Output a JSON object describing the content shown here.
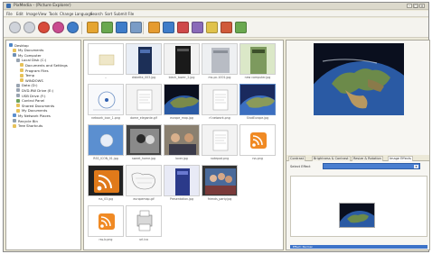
{
  "window": {
    "title": "PixMedia - (Picture Explorer)"
  },
  "menubar": {
    "items": [
      "File",
      "Edit",
      "Image",
      "View",
      "Tools",
      "Change Language",
      "Search",
      "Sort",
      "Submit File"
    ]
  },
  "toolbar": {
    "icons": [
      "back-icon",
      "forward-icon",
      "refresh-icon",
      "stop-icon",
      "globe-icon",
      "copy-icon",
      "move-icon",
      "delete-icon",
      "rename-icon",
      "slideshow-icon",
      "print-icon",
      "email-icon",
      "wallpaper-icon",
      "rotate-icon",
      "crop-icon",
      "settings-icon"
    ]
  },
  "tree": {
    "items": [
      {
        "label": "Desktop",
        "indent": 0,
        "color": "#4f86c6"
      },
      {
        "label": "My Documents",
        "indent": 1,
        "color": "#e7c25a"
      },
      {
        "label": "My Computer",
        "indent": 1,
        "color": "#6e8fb5"
      },
      {
        "label": "Local Disk (C:)",
        "indent": 2,
        "color": "#9aa5b2"
      },
      {
        "label": "Documents and Settings",
        "indent": 3,
        "color": "#e7c25a"
      },
      {
        "label": "Program Files",
        "indent": 3,
        "color": "#e7c25a"
      },
      {
        "label": "Temp",
        "indent": 3,
        "color": "#e7c25a"
      },
      {
        "label": "WINDOWS",
        "indent": 3,
        "color": "#e7c25a"
      },
      {
        "label": "Data (D:)",
        "indent": 2,
        "color": "#9aa5b2"
      },
      {
        "label": "DVD-RW Drive (E:)",
        "indent": 2,
        "color": "#9aa5b2"
      },
      {
        "label": "USB Drive (F:)",
        "indent": 2,
        "color": "#9aa5b2"
      },
      {
        "label": "Control Panel",
        "indent": 2,
        "color": "#6da35a"
      },
      {
        "label": "Shared Documents",
        "indent": 2,
        "color": "#e7c25a"
      },
      {
        "label": "My Documents",
        "indent": 2,
        "color": "#e7c25a"
      },
      {
        "label": "My Network Places",
        "indent": 1,
        "color": "#5b8fd0"
      },
      {
        "label": "Recycle Bin",
        "indent": 1,
        "color": "#8fa0b0"
      },
      {
        "label": "Tree Shortcuts",
        "indent": 1,
        "color": "#e7c25a"
      }
    ]
  },
  "thumbnails": [
    {
      "caption": "..",
      "kind": "folder"
    },
    {
      "caption": "diskette_003.jpg",
      "kind": "tower-blue"
    },
    {
      "caption": "black_tower_2.jpg",
      "kind": "tower-black"
    },
    {
      "caption": "ms-pc-1001.jpg",
      "kind": "tower-silver"
    },
    {
      "caption": "new computer.jpg",
      "kind": "tower-green"
    },
    {
      "caption": "network_icon_1.png",
      "kind": "map-white"
    },
    {
      "caption": "dome_elegante.gif",
      "kind": "doc-grey"
    },
    {
      "caption": "europe_map.jpg",
      "kind": "satellite"
    },
    {
      "caption": "rf-network.png",
      "kind": "doc-grey"
    },
    {
      "caption": "ShotEurope.jpg",
      "kind": "satellite-sel"
    },
    {
      "caption": "RSS_ICON_01.jpg",
      "kind": "blue-sphere"
    },
    {
      "caption": "sweet_home.jpg",
      "kind": "photo-bw"
    },
    {
      "caption": "lover.jpg",
      "kind": "photo-people"
    },
    {
      "caption": "notepad.png",
      "kind": "doc-grey"
    },
    {
      "caption": "rss.png",
      "kind": "rss"
    },
    {
      "caption": "rss_03.jpg",
      "kind": "rss-dark"
    },
    {
      "caption": "europemap.gif",
      "kind": "map-line"
    },
    {
      "caption": "Presentation.jpg",
      "kind": "tower-purple"
    },
    {
      "caption": "friends_party.jpg",
      "kind": "photo-group"
    },
    {
      "caption": "",
      "kind": "empty"
    },
    {
      "caption": "rss-b.png",
      "kind": "rss"
    },
    {
      "caption": "url.ico",
      "kind": "printer"
    }
  ],
  "preview": {
    "tabs": [
      "Contrast",
      "Brightness & Contrast",
      "Resize & Rotation",
      "Image Effects"
    ],
    "active_tab": "Image Effects",
    "select_label": "Select Effect",
    "effect_caption": "Effect: Normal"
  },
  "colors": {
    "selection": "#3d73c8",
    "window_bg": "#ece9d8"
  }
}
